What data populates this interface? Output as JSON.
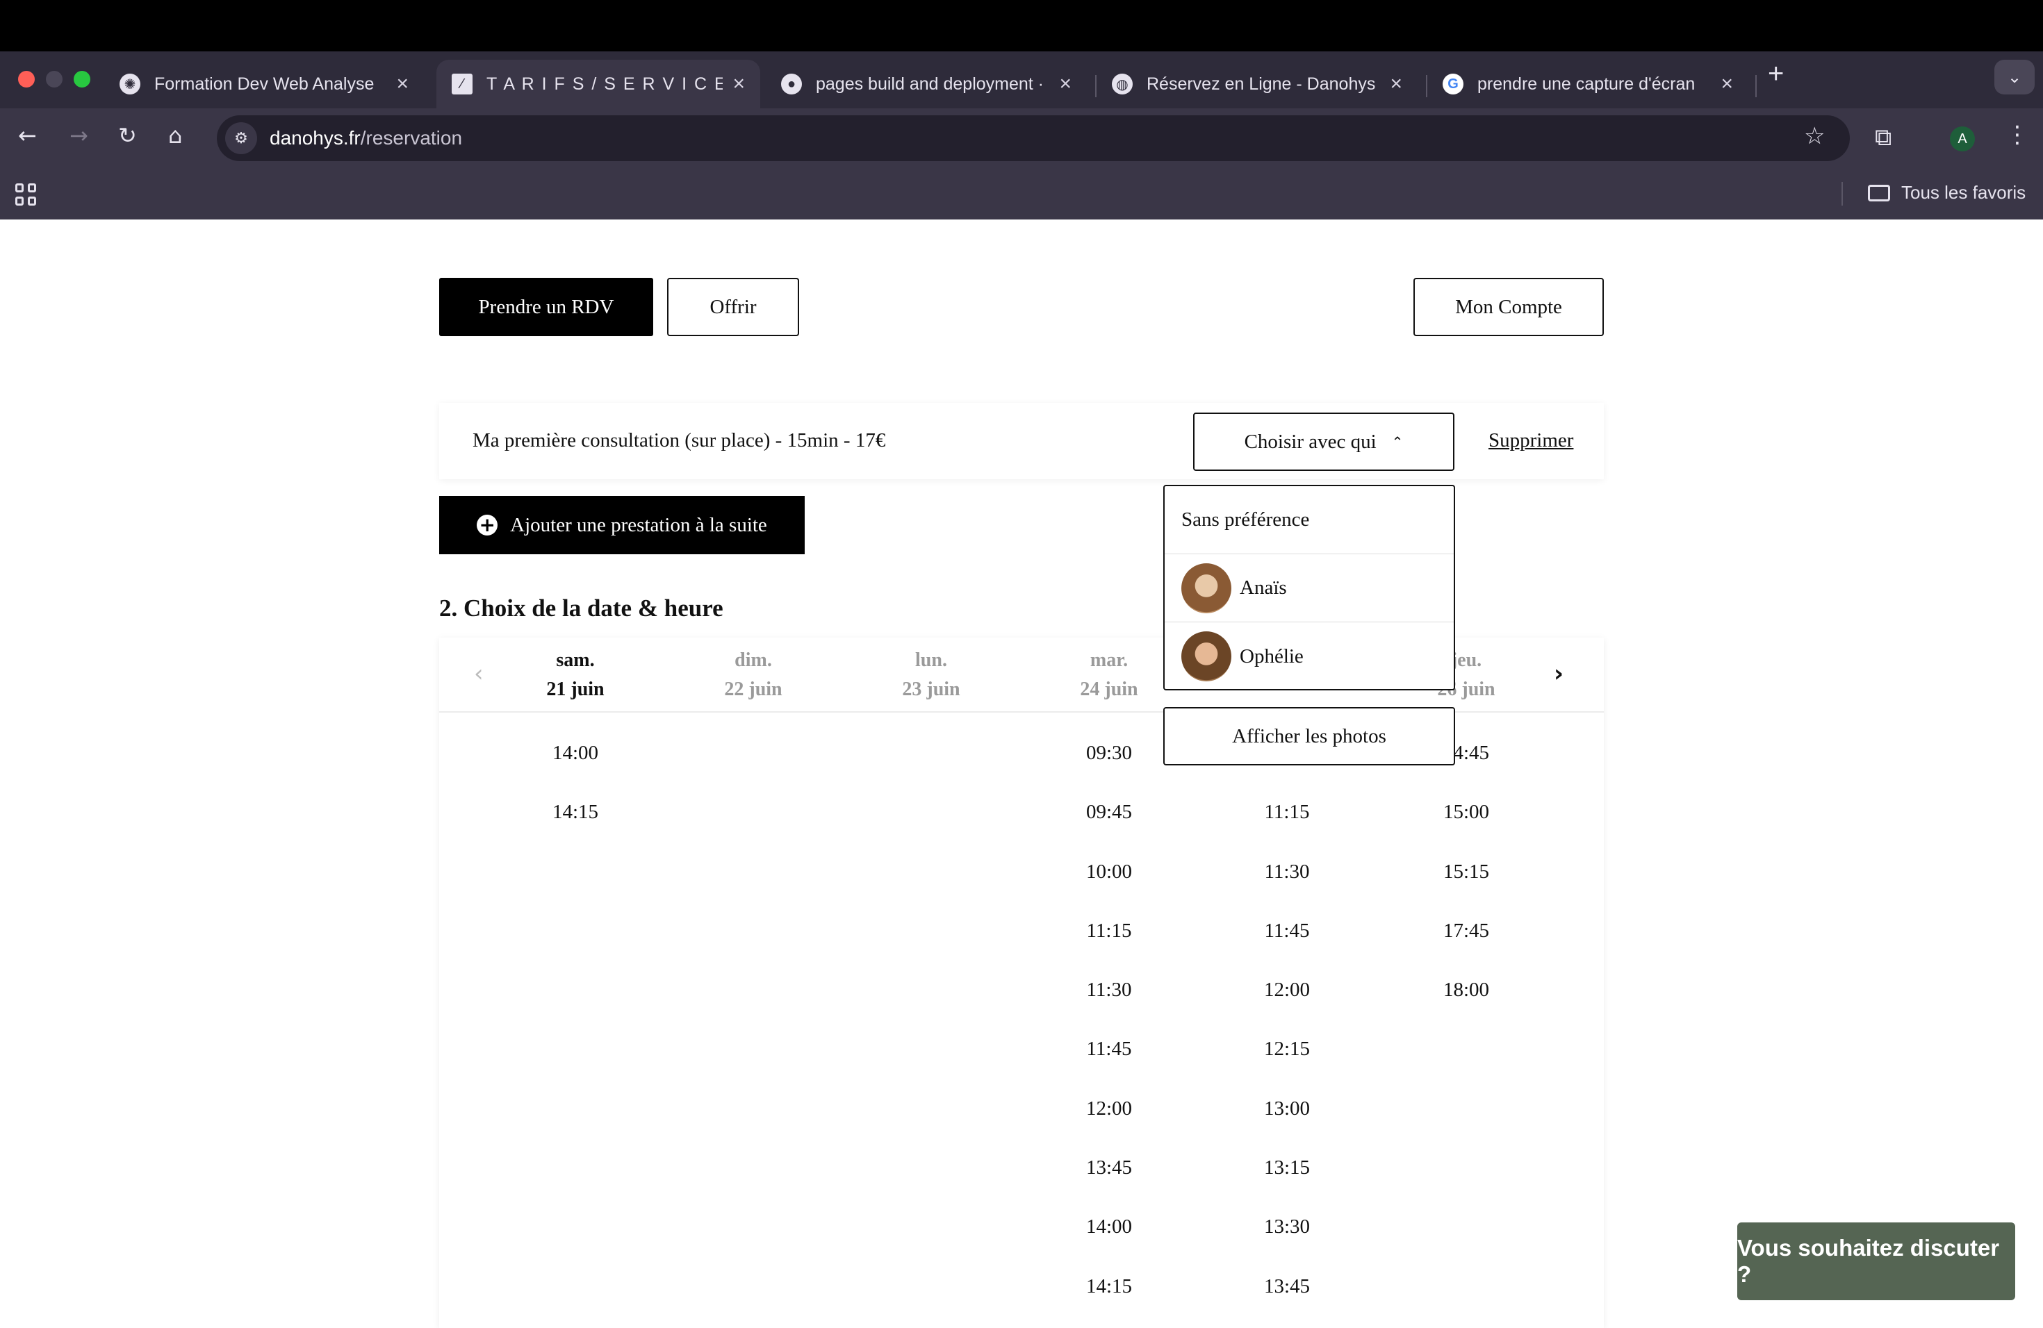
{
  "browser": {
    "tabs": [
      {
        "title": "Formation Dev Web Analyse",
        "icon": "openai-icon"
      },
      {
        "title": "T A R I F S / S E R V I C E S | D",
        "icon": "brand-icon"
      },
      {
        "title": "pages build and deployment ·",
        "icon": "github-icon"
      },
      {
        "title": "Réservez en Ligne - Danohys",
        "icon": "globe-icon"
      },
      {
        "title": "prendre une capture d'écran",
        "icon": "google-icon"
      }
    ],
    "url_domain": "danohys.fr",
    "url_path": "/reservation",
    "profile_initial": "A",
    "bookmarks_folder": "Tous les favoris"
  },
  "header": {
    "rdv_label": "Prendre un RDV",
    "gift_label": "Offrir",
    "account_label": "Mon Compte"
  },
  "service": {
    "name": "Ma première consultation (sur place) - 15min - 17€",
    "choose_label": "Choisir avec qui",
    "delete_label": "Supprimer",
    "add_label": "Ajouter une prestation à la suite"
  },
  "dropdown": {
    "options": [
      "Sans préférence",
      "Anaïs",
      "Ophélie"
    ],
    "photos_label": "Afficher les photos"
  },
  "calendar": {
    "title": "2. Choix de la date & heure",
    "days": [
      {
        "weekday": "sam.",
        "date": "21 juin",
        "active": true
      },
      {
        "weekday": "dim.",
        "date": "22 juin",
        "active": false
      },
      {
        "weekday": "lun.",
        "date": "23 juin",
        "active": false
      },
      {
        "weekday": "mar.",
        "date": "24 juin",
        "active": false
      },
      {
        "weekday": "",
        "date": "",
        "active": false
      },
      {
        "weekday": "jeu.",
        "date": "26 juin",
        "active": false
      }
    ],
    "slots": [
      [
        "14:00",
        "14:15"
      ],
      [],
      [],
      [
        "09:30",
        "09:45",
        "10:00",
        "11:15",
        "11:30",
        "11:45",
        "12:00",
        "13:45",
        "14:00",
        "14:15"
      ],
      [
        "",
        "11:15",
        "11:30",
        "11:45",
        "12:00",
        "12:15",
        "13:00",
        "13:15",
        "13:30",
        "13:45"
      ],
      [
        "14:45",
        "15:00",
        "15:15",
        "17:45",
        "18:00"
      ]
    ]
  },
  "chat": {
    "label": "Vous souhaitez discuter ?"
  },
  "colors": {
    "chat_bg": "#556553",
    "primary": "#000000"
  }
}
